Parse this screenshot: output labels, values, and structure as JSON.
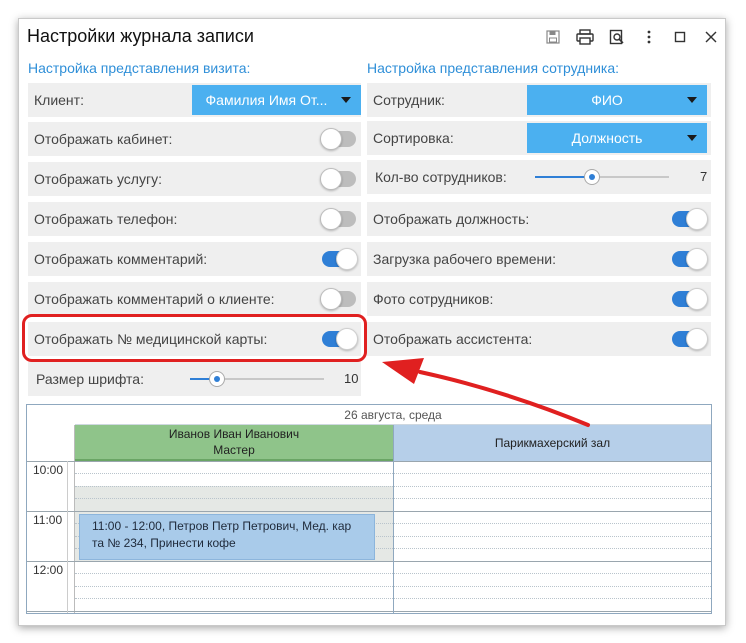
{
  "window": {
    "title": "Настройки журнала записи",
    "icons": [
      "save-icon",
      "print-icon",
      "preview-icon",
      "more-icon",
      "maximize-icon",
      "close-icon"
    ]
  },
  "visit_section": {
    "title": "Настройка представления визита:",
    "client_label": "Клиент:",
    "client_value": "Фамилия Имя От...",
    "toggles": [
      {
        "label": "Отображать кабинет:",
        "on": false
      },
      {
        "label": "Отображать услугу:",
        "on": false
      },
      {
        "label": "Отображать телефон:",
        "on": false
      },
      {
        "label": "Отображать комментарий:",
        "on": true
      },
      {
        "label": "Отображать комментарий о клиенте:",
        "on": false
      },
      {
        "label": "Отображать № медицинской карты:",
        "on": true
      }
    ],
    "font_size_label": "Размер шрифта:",
    "font_size_value": "10"
  },
  "employee_section": {
    "title": "Настройка представления сотрудника:",
    "employee_label": "Сотрудник:",
    "employee_value": "ФИО",
    "sort_label": "Сортировка:",
    "sort_value": "Должность",
    "count_label": "Кол-во сотрудников:",
    "count_value": "7",
    "toggles": [
      {
        "label": "Отображать должность:",
        "on": true
      },
      {
        "label": "Загрузка рабочего времени:",
        "on": true
      },
      {
        "label": "Фото сотрудников:",
        "on": true
      },
      {
        "label": "Отображать ассистента:",
        "on": true
      }
    ]
  },
  "calendar": {
    "date": "26 августа, среда",
    "columns": [
      {
        "line1": "Иванов Иван Иванович",
        "line2": "Мастер",
        "color": "#8fc48a"
      },
      {
        "line1": "Парикмахерский зал",
        "line2": "",
        "color": "#b6cfe9"
      }
    ],
    "times": [
      "10:00",
      "11:00",
      "12:00"
    ],
    "appointment": {
      "line1": "11:00 - 12:00, Петров Петр Петрович, Мед. кар",
      "line2": "та № 234, Принести кофе"
    }
  },
  "colors": {
    "accent": "#2f8fd8",
    "dropdown": "#4bb0f0",
    "toggle_on": "#2f7fd6",
    "highlight": "#e02020"
  }
}
